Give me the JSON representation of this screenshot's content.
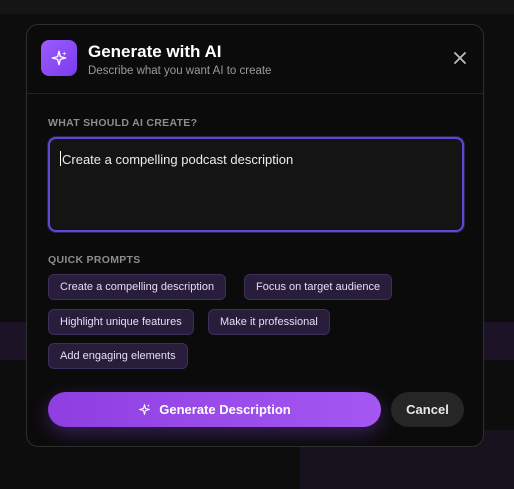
{
  "dialog": {
    "title": "Generate with AI",
    "subtitle": "Describe what you want AI to create",
    "icon": "sparkle-icon",
    "accent": "#8b45e8"
  },
  "prompt": {
    "label": "WHAT SHOULD AI CREATE?",
    "value": "Create a compelling podcast description"
  },
  "quick_prompts": {
    "label": "QUICK PROMPTS",
    "items": [
      "Create a compelling description",
      "Focus on target audience",
      "Highlight unique features",
      "Make it professional",
      "Add engaging elements"
    ]
  },
  "actions": {
    "generate_label": "Generate Description",
    "cancel_label": "Cancel"
  }
}
